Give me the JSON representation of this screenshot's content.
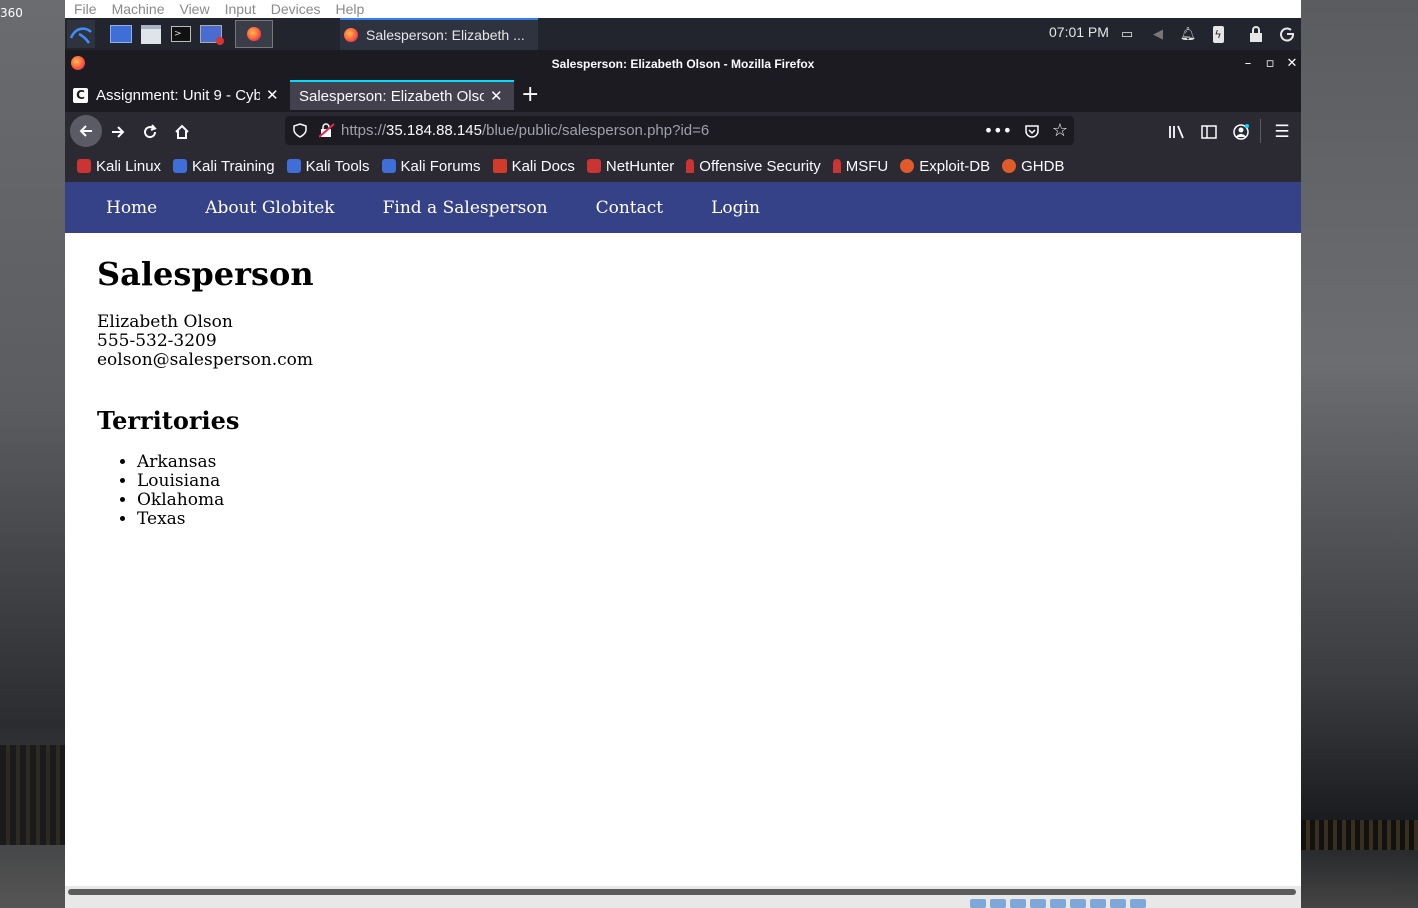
{
  "desktop": {
    "corner_label": "360"
  },
  "vbox_menu": {
    "items": [
      "File",
      "Machine",
      "View",
      "Input",
      "Devices",
      "Help"
    ]
  },
  "panel": {
    "task_label": "Salesperson: Elizabeth ...",
    "clock": "07:01 PM"
  },
  "window": {
    "title": "Salesperson: Elizabeth Olson - Mozilla Firefox",
    "tabs": [
      {
        "label": "Assignment: Unit 9 - Cyb",
        "favicon": "C"
      },
      {
        "label": "Salesperson: Elizabeth Olson"
      }
    ],
    "url": {
      "scheme": "https://",
      "host": "35.184.88.145",
      "path": "/blue/public/salesperson.php?id=6"
    },
    "bookmarks": [
      "Kali Linux",
      "Kali Training",
      "Kali Tools",
      "Kali Forums",
      "Kali Docs",
      "NetHunter",
      "Offensive Security",
      "MSFU",
      "Exploit-DB",
      "GHDB"
    ]
  },
  "site": {
    "nav": [
      "Home",
      "About Globitek",
      "Find a Salesperson",
      "Contact",
      "Login"
    ],
    "heading": "Salesperson",
    "name": "Elizabeth Olson",
    "phone": "555-532-3209",
    "email": "eolson@salesperson.com",
    "territories_heading": "Territories",
    "territories": [
      "Arkansas",
      "Louisiana",
      "Oklahoma",
      "Texas"
    ]
  },
  "colors": {
    "site_nav": "#354288",
    "tab_accent": "#00ddff",
    "panel_accent": "#367bf0"
  }
}
